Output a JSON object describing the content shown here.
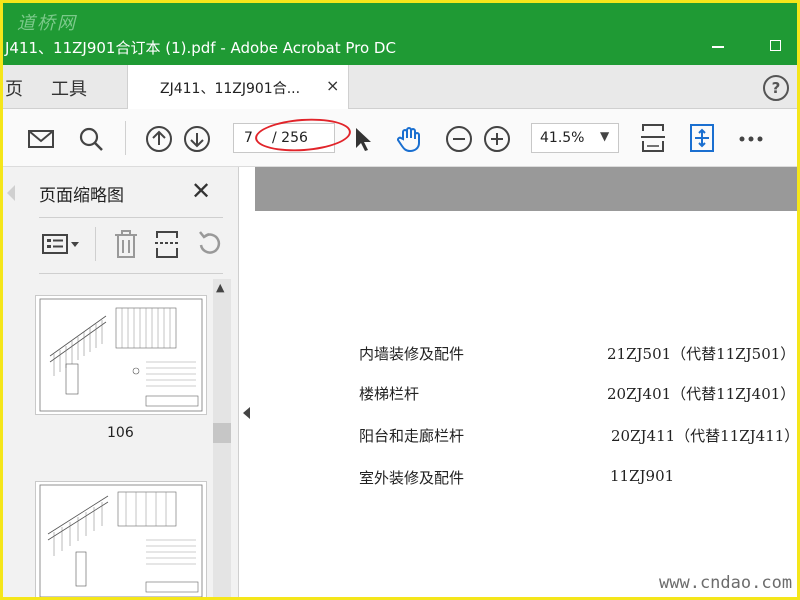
{
  "watermark_top": "道桥网",
  "window": {
    "title": "J411、11ZJ901合订本 (1).pdf - Adobe Acrobat Pro DC"
  },
  "tabbar": {
    "home_label": "页",
    "tools_label": "工具",
    "doc_tab_label": "ZJ411、11ZJ901合...",
    "doc_tab_close": "×",
    "help_label": "?"
  },
  "toolbar": {
    "page_current": "7",
    "page_total": "/ 256",
    "zoom_value": "41.5%",
    "zoom_caret": "▼",
    "icons": [
      "mail-icon",
      "search-icon",
      "page-up-icon",
      "page-down-icon",
      "select-arrow-icon",
      "hand-icon",
      "zoom-out-icon",
      "zoom-in-icon",
      "fit-page-icon",
      "scroll-mode-icon",
      "more-icon"
    ]
  },
  "sidebar": {
    "title": "页面缩略图",
    "close_label": "✕",
    "thumbnail_label": "106",
    "icons": [
      "thumbnail-options-icon",
      "delete-icon",
      "insert-page-icon",
      "rotate-icon"
    ]
  },
  "document": {
    "rows": [
      {
        "name": "内墙装修及配件",
        "code": "21ZJ501（代替11ZJ501）"
      },
      {
        "name": "楼梯栏杆",
        "code": "20ZJ401（代替11ZJ401）"
      },
      {
        "name": "阳台和走廊栏杆",
        "code": "20ZJ411（代替11ZJ411）"
      },
      {
        "name": "室外装修及配件",
        "code": "11ZJ901"
      }
    ]
  },
  "watermark_bottom": "www.cndao.com",
  "colors": {
    "titlebar": "#1f9a34",
    "frame_border": "#f5e61a",
    "annotation_oval": "#e1242a",
    "hand_tool": "#1a6fd0"
  }
}
